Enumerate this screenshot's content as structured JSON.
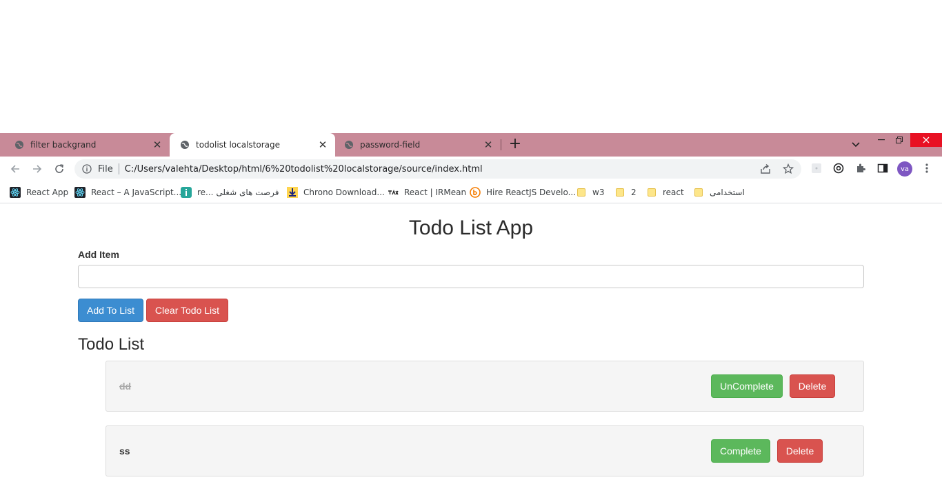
{
  "browser": {
    "tabs": [
      {
        "title": "filter backgrand",
        "active": false
      },
      {
        "title": "todolist localstorage",
        "active": true
      },
      {
        "title": "password-field",
        "active": false
      }
    ],
    "address": {
      "scheme_label": "File",
      "url": "C:/Users/valehta/Desktop/html/6%20todolist%20localstorage/source/index.html"
    },
    "profile_initials": "va",
    "accent_color": "#c88a98",
    "bookmarks": [
      {
        "label": "React App",
        "icon": "react-icon"
      },
      {
        "label": "React – A JavaScript...",
        "icon": "react-icon"
      },
      {
        "label": "re... فرصت های شغلی",
        "icon": "jobinja-icon"
      },
      {
        "label": "Chrono Download...",
        "icon": "download-icon"
      },
      {
        "label": "React | IRMean",
        "icon": "irmean-icon"
      },
      {
        "label": "Hire ReactJS Develo...",
        "icon": "hire-icon"
      },
      {
        "label": "w3",
        "icon": "folder-icon"
      },
      {
        "label": "2",
        "icon": "folder-icon"
      },
      {
        "label": "react",
        "icon": "folder-icon"
      },
      {
        "label": "استخدامی",
        "icon": "folder-icon"
      }
    ]
  },
  "app": {
    "title": "Todo List App",
    "input_label": "Add Item",
    "input_value": "",
    "add_button": "Add To List",
    "clear_button": "Clear Todo List",
    "list_title": "Todo List",
    "items": [
      {
        "text": "dd",
        "completed": true,
        "toggle_label": "UnComplete",
        "delete_label": "Delete"
      },
      {
        "text": "ss",
        "completed": false,
        "toggle_label": "Complete",
        "delete_label": "Delete"
      }
    ],
    "colors": {
      "primary": "#3c8dd1",
      "danger": "#d9534f",
      "success": "#5cb85c"
    }
  }
}
